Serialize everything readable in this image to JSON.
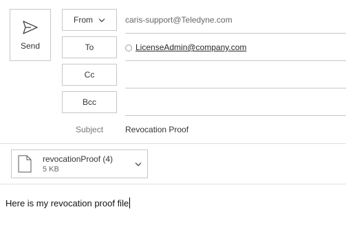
{
  "compose": {
    "send_label": "Send",
    "from_label": "From",
    "from_value": "caris-support@Teledyne.com",
    "to_label": "To",
    "to_recipient": "LicenseAdmin@company.com",
    "cc_label": "Cc",
    "cc_value": "",
    "bcc_label": "Bcc",
    "bcc_value": "",
    "subject_label": "Subject",
    "subject_value": "Revocation Proof"
  },
  "attachment": {
    "name": "revocationProof (4)",
    "size": "5 KB",
    "icon": "file-icon"
  },
  "body": {
    "text": "Here is my revocation proof file"
  },
  "icons": [
    "send-icon",
    "chevron-down-icon",
    "presence-icon",
    "file-icon"
  ]
}
